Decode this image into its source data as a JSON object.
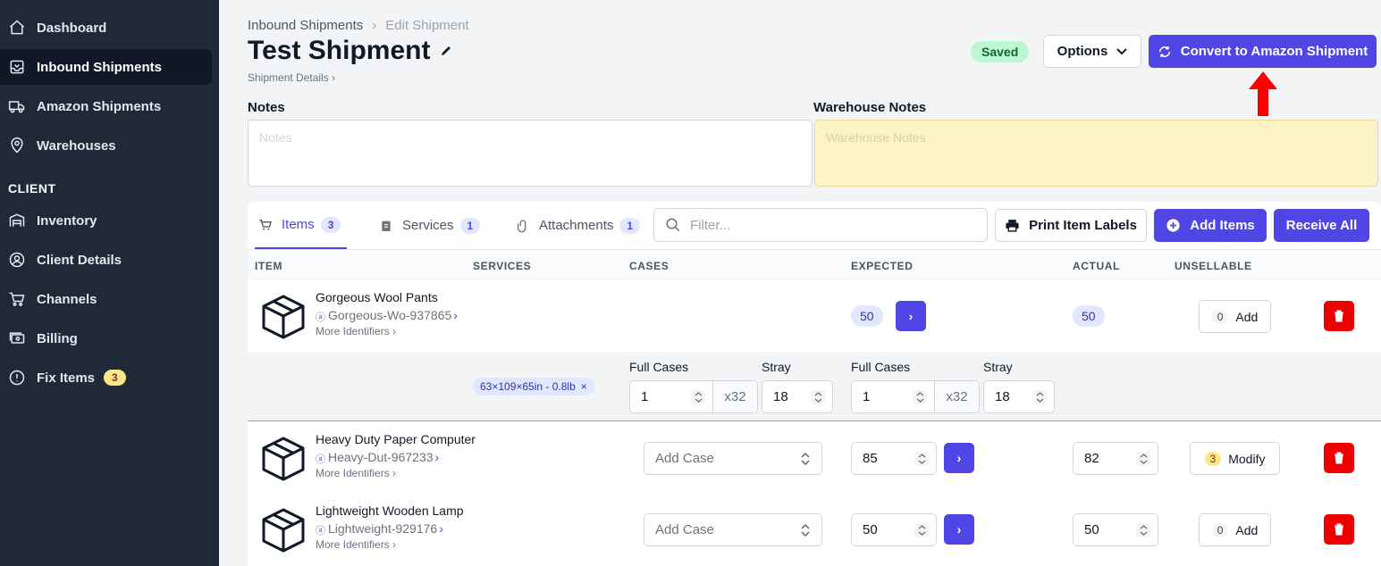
{
  "sidebar": {
    "items": [
      {
        "label": "Dashboard",
        "icon": "home-icon"
      },
      {
        "label": "Inbound Shipments",
        "icon": "inbox-icon"
      },
      {
        "label": "Amazon Shipments",
        "icon": "truck-icon"
      },
      {
        "label": "Warehouses",
        "icon": "location-pin-icon"
      }
    ],
    "section": "CLIENT",
    "client_items": [
      {
        "label": "Inventory",
        "icon": "warehouse-icon"
      },
      {
        "label": "Client Details",
        "icon": "user-circle-icon"
      },
      {
        "label": "Channels",
        "icon": "cart-icon"
      },
      {
        "label": "Billing",
        "icon": "billing-icon"
      },
      {
        "label": "Fix Items",
        "icon": "alert-circle-icon",
        "badge": "3"
      }
    ]
  },
  "header": {
    "breadcrumb_root": "Inbound Shipments",
    "breadcrumb_current": "Edit Shipment",
    "title": "Test Shipment",
    "subcrumb": "Shipment Details",
    "status": "Saved",
    "options_label": "Options",
    "convert_label": "Convert to Amazon Shipment"
  },
  "notes": {
    "label": "Notes",
    "placeholder": "Notes",
    "warehouse_label": "Warehouse Notes",
    "warehouse_placeholder": "Warehouse Notes"
  },
  "tabs": [
    {
      "label": "Items",
      "count": "3"
    },
    {
      "label": "Services",
      "count": "1"
    },
    {
      "label": "Attachments",
      "count": "1"
    }
  ],
  "toolbar": {
    "filter_placeholder": "Filter...",
    "print_label": "Print Item Labels",
    "add_items_label": "Add Items",
    "receive_all_label": "Receive All"
  },
  "columns": [
    "ITEM",
    "SERVICES",
    "CASES",
    "EXPECTED",
    "ACTUAL",
    "UNSELLABLE"
  ],
  "items": [
    {
      "name": "Gorgeous Wool Pants",
      "sku": "Gorgeous-Wo-937865",
      "more": "More Identifiers",
      "expected": "50",
      "actual": "50",
      "unsellable_count": "0",
      "unsellable_action": "Add",
      "cases": {
        "dims": "63×109×65in - 0.8lb",
        "full_cases_label": "Full Cases",
        "stray_label": "Stray",
        "expected_full_cases": "1",
        "expected_multiplier": "x32",
        "expected_stray": "18",
        "actual_full_cases": "1",
        "actual_multiplier": "x32",
        "actual_stray": "18"
      }
    },
    {
      "name": "Heavy Duty Paper Computer",
      "sku": "Heavy-Dut-967233",
      "more": "More Identifiers",
      "case_placeholder": "Add Case",
      "expected": "85",
      "actual": "82",
      "unsellable_count": "3",
      "unsellable_action": "Modify"
    },
    {
      "name": "Lightweight Wooden Lamp",
      "sku": "Lightweight-929176",
      "more": "More Identifiers",
      "case_placeholder": "Add Case",
      "expected": "50",
      "actual": "50",
      "unsellable_count": "0",
      "unsellable_action": "Add"
    }
  ],
  "colors": {
    "sidebar_bg": "#1f2937",
    "accent": "#4f46e5",
    "danger": "#ef0000",
    "saved_bg": "#bbf7d0",
    "warehouse_notes_bg": "#fef3c7"
  }
}
